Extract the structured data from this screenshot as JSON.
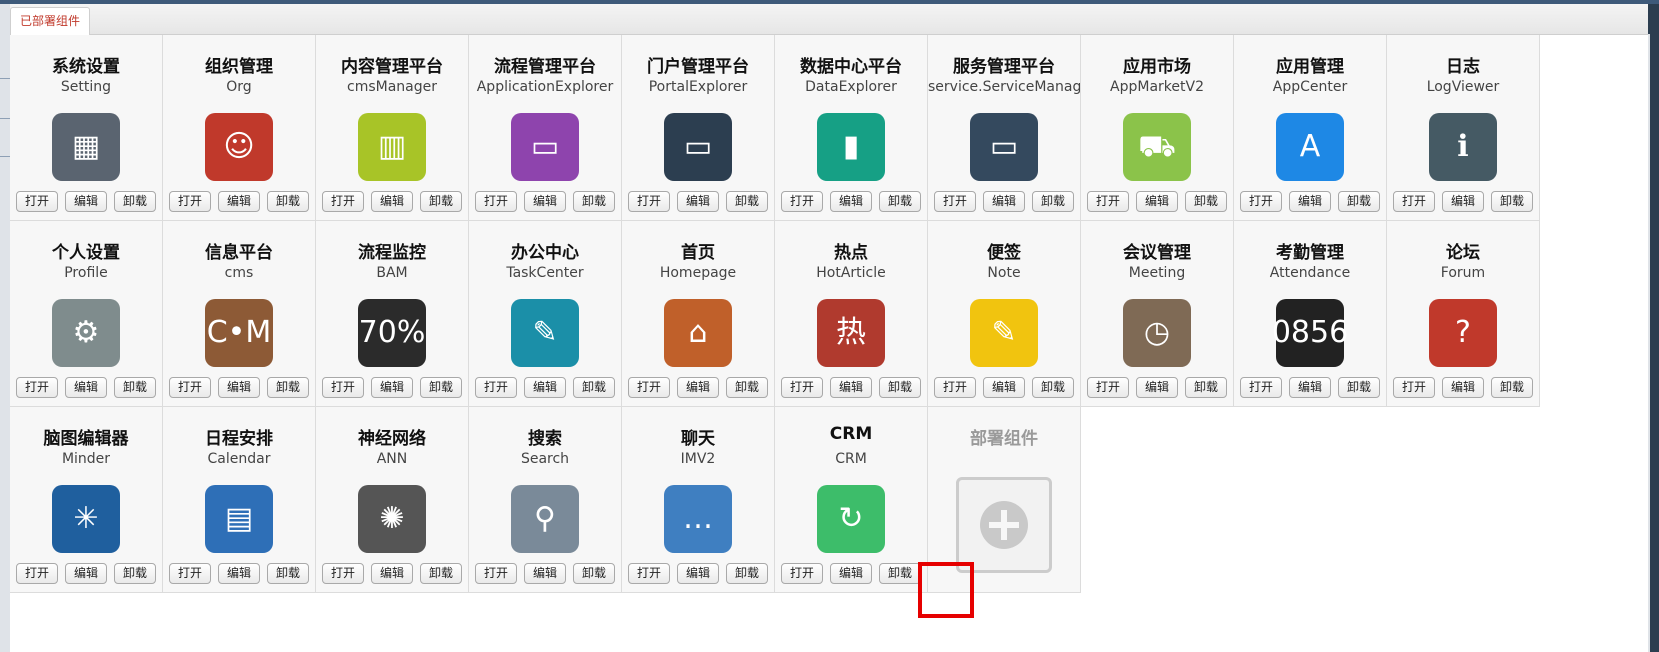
{
  "tab": {
    "label": "已部署组件"
  },
  "buttons": {
    "open": "打开",
    "edit": "编辑",
    "uninstall": "卸载"
  },
  "deploy": {
    "label": "部署组件"
  },
  "components": [
    {
      "title": "系统设置",
      "code": "Setting",
      "icon": "server-stack-icon",
      "color": "#5a6470",
      "glyph": "▦"
    },
    {
      "title": "组织管理",
      "code": "Org",
      "icon": "businessman-icon",
      "color": "#c0392b",
      "glyph": "☺"
    },
    {
      "title": "内容管理平台",
      "code": "cmsManager",
      "icon": "binders-icon",
      "color": "#a8c427",
      "glyph": "▥"
    },
    {
      "title": "流程管理平台",
      "code": "ApplicationExplorer",
      "icon": "monitor-workflow-icon",
      "color": "#8e44ad",
      "glyph": "▭"
    },
    {
      "title": "门户管理平台",
      "code": "PortalExplorer",
      "icon": "monitor-portal-icon",
      "color": "#2c3e50",
      "glyph": "▭"
    },
    {
      "title": "数据中心平台",
      "code": "DataExplorer",
      "icon": "monitor-chart-icon",
      "color": "#16a085",
      "glyph": "▮"
    },
    {
      "title": "服务管理平台",
      "code": "service.ServiceManager",
      "icon": "monitor-service-icon",
      "color": "#34495e",
      "glyph": "▭"
    },
    {
      "title": "应用市场",
      "code": "AppMarketV2",
      "icon": "shopping-bag-icon",
      "color": "#8bc34a",
      "glyph": "⛟"
    },
    {
      "title": "应用管理",
      "code": "AppCenter",
      "icon": "monitor-appstore-icon",
      "color": "#1e88e5",
      "glyph": "A"
    },
    {
      "title": "日志",
      "code": "LogViewer",
      "icon": "log-window-icon",
      "color": "#455a64",
      "glyph": "ℹ"
    },
    {
      "title": "个人设置",
      "code": "Profile",
      "icon": "gear-icon",
      "color": "#7f8c8d",
      "glyph": "⚙"
    },
    {
      "title": "信息平台",
      "code": "cms",
      "icon": "book-magnifier-icon",
      "color": "#8d5a36",
      "glyph": "C•M"
    },
    {
      "title": "流程监控",
      "code": "BAM",
      "icon": "gauge-icon",
      "color": "#2b2b2b",
      "glyph": "70%"
    },
    {
      "title": "办公中心",
      "code": "TaskCenter",
      "icon": "notebook-pen-icon",
      "color": "#1b8fa8",
      "glyph": "✎"
    },
    {
      "title": "首页",
      "code": "Homepage",
      "icon": "house-icon",
      "color": "#c0602a",
      "glyph": "⌂"
    },
    {
      "title": "热点",
      "code": "HotArticle",
      "icon": "hotspot-icon",
      "color": "#b03a2e",
      "glyph": "热"
    },
    {
      "title": "便签",
      "code": "Note",
      "icon": "sticky-note-icon",
      "color": "#f1c40f",
      "glyph": "✎"
    },
    {
      "title": "会议管理",
      "code": "Meeting",
      "icon": "clipboard-clock-icon",
      "color": "#7f6a55",
      "glyph": "◷"
    },
    {
      "title": "考勤管理",
      "code": "Attendance",
      "icon": "fingerprint-reader-icon",
      "color": "#222222",
      "glyph": "0856"
    },
    {
      "title": "论坛",
      "code": "Forum",
      "icon": "forum-people-icon",
      "color": "#c0392b",
      "glyph": "?"
    },
    {
      "title": "脑图编辑器",
      "code": "Minder",
      "icon": "mindmap-icon",
      "color": "#1f5f9e",
      "glyph": "✳"
    },
    {
      "title": "日程安排",
      "code": "Calendar",
      "icon": "calendar-icon",
      "color": "#2e6fb7",
      "glyph": "▤"
    },
    {
      "title": "神经网络",
      "code": "ANN",
      "icon": "brain-head-icon",
      "color": "#555555",
      "glyph": "✺"
    },
    {
      "title": "搜索",
      "code": "Search",
      "icon": "magnifier-icon",
      "color": "#7a8a99",
      "glyph": "⚲"
    },
    {
      "title": "聊天",
      "code": "IMV2",
      "icon": "chat-bubble-icon",
      "color": "#3f7fc1",
      "glyph": "…"
    },
    {
      "title": "CRM",
      "code": "CRM",
      "icon": "crm-cycle-icon",
      "color": "#3dbd6a",
      "glyph": "↻"
    }
  ]
}
